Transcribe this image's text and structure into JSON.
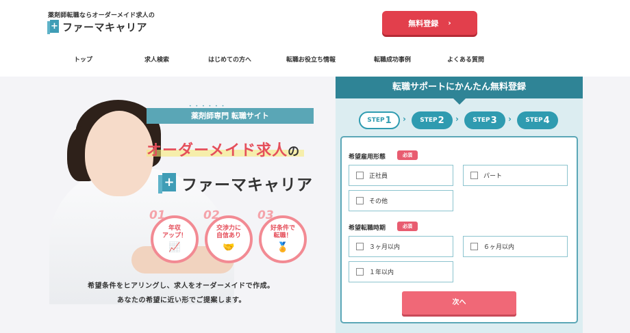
{
  "header": {
    "tagline": "薬剤師転職ならオーダーメイド求人の",
    "logo_mark": "+",
    "logo_text": "ファーマキャリア",
    "cta_label": "無料登録",
    "cta_icon": "›"
  },
  "nav": {
    "items": [
      "トップ",
      "求人検索",
      "はじめての方へ",
      "転職お役立ち情報",
      "転職成功事例",
      "よくある質問"
    ]
  },
  "hero": {
    "badge": "薬剤師専門 転職サイト",
    "dots": "••••••",
    "headline_main": "オーダーメイド求人",
    "headline_suffix": "の",
    "logo_mark": "+",
    "logo_text": "ファーマキャリア",
    "features": [
      {
        "num": "01",
        "label_line1": "年収",
        "label_line2": "アップ！",
        "icon": "📈"
      },
      {
        "num": "02",
        "label_line1": "交渉力に",
        "label_line2": "自信あり",
        "icon": "🤝"
      },
      {
        "num": "03",
        "label_line1": "好条件で",
        "label_line2": "転職！",
        "icon": "🏅"
      }
    ],
    "description_line1": "希望条件をヒアリングし、求人をオーダーメイドで作成。",
    "description_line2": "あなたの希望に近い形でご提案します。"
  },
  "form": {
    "title": "転職サポートにかんたん無料登録",
    "steps": [
      {
        "label": "STEP",
        "num": "1",
        "active": true
      },
      {
        "label": "STEP",
        "num": "2",
        "active": false
      },
      {
        "label": "STEP",
        "num": "3",
        "active": false
      },
      {
        "label": "STEP",
        "num": "4",
        "active": false
      }
    ],
    "step_arrow": "›",
    "questions": [
      {
        "label": "希望雇用形態",
        "required_label": "必須",
        "options": [
          "正社員",
          "パート",
          "その他"
        ]
      },
      {
        "label": "希望転職時期",
        "required_label": "必須",
        "options": [
          "３ヶ月以内",
          "６ヶ月以内",
          "１年以内"
        ]
      }
    ],
    "next_label": "次へ"
  },
  "colors": {
    "brand_teal": "#2f8496",
    "accent_red": "#e23f4c",
    "button_pink": "#f06877"
  }
}
